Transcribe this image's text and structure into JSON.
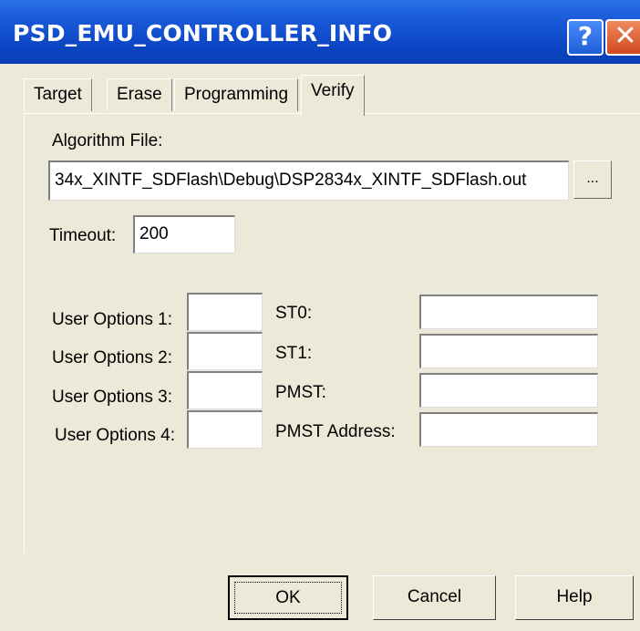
{
  "window": {
    "title": "PSD_EMU_CONTROLLER_INFO",
    "help_glyph": "?",
    "close_glyph": "✕"
  },
  "tabs": [
    {
      "label": "Target"
    },
    {
      "label": "Erase"
    },
    {
      "label": "Programming"
    },
    {
      "label": "Verify",
      "active": true
    }
  ],
  "verify": {
    "algorithm_label": "Algorithm File:",
    "algorithm_value": "34x_XINTF_SDFlash\\Debug\\DSP2834x_XINTF_SDFlash.out",
    "browse_label": "...",
    "timeout_label": "Timeout:",
    "timeout_value": "200",
    "user_options": [
      {
        "label": "User Options 1:",
        "value": ""
      },
      {
        "label": "User Options 2:",
        "value": ""
      },
      {
        "label": "User Options 3:",
        "value": ""
      },
      {
        "label": "User Options 4:",
        "value": ""
      }
    ],
    "registers": [
      {
        "label": "ST0:",
        "value": ""
      },
      {
        "label": "ST1:",
        "value": ""
      },
      {
        "label": "PMST:",
        "value": ""
      },
      {
        "label": "PMST Address:",
        "value": ""
      }
    ]
  },
  "buttons": {
    "ok": "OK",
    "cancel": "Cancel",
    "help": "Help"
  }
}
